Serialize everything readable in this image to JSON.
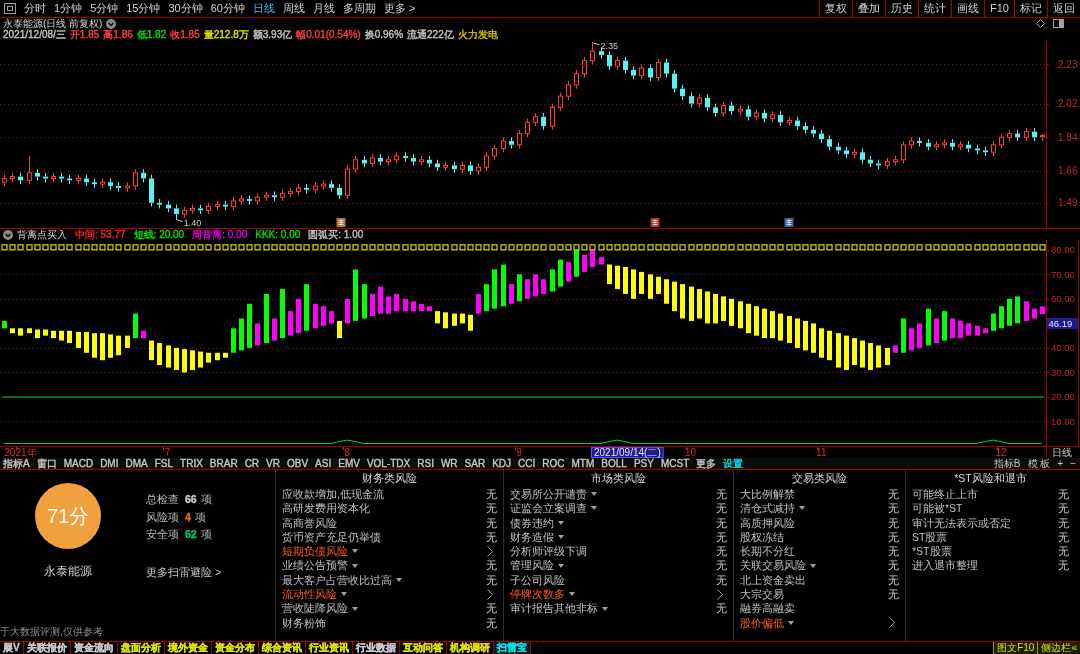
{
  "toolbar": {
    "periods": [
      {
        "label": "分时",
        "selected": false
      },
      {
        "label": "1分钟",
        "selected": false
      },
      {
        "label": "5分钟",
        "selected": false
      },
      {
        "label": "15分钟",
        "selected": false
      },
      {
        "label": "30分钟",
        "selected": false
      },
      {
        "label": "60分钟",
        "selected": false
      },
      {
        "label": "日线",
        "selected": true
      },
      {
        "label": "周线",
        "selected": false
      },
      {
        "label": "月线",
        "selected": false
      },
      {
        "label": "多周期",
        "selected": false
      },
      {
        "label": "更多 >",
        "selected": false
      }
    ],
    "actions": [
      "复权",
      "叠加",
      "历史",
      "统计",
      "画线",
      "F10",
      "标记",
      "返回"
    ]
  },
  "quote": {
    "title": "永泰能源(日线 前复权)",
    "fields": [
      {
        "text": "2021/12/08/三",
        "color": "#c8c8c8"
      },
      {
        "text": "开1.85",
        "color": "#ff4040"
      },
      {
        "text": "高1.86",
        "color": "#ff4040"
      },
      {
        "text": "低1.82",
        "color": "#00e000"
      },
      {
        "text": "收1.85",
        "color": "#ff4040"
      },
      {
        "text": "量212.8万",
        "color": "#e0e000"
      },
      {
        "text": "额3.93亿",
        "color": "#c8c8c8"
      },
      {
        "text": "幅0.01(0.54%)",
        "color": "#ff4040"
      },
      {
        "text": "换0.96%",
        "color": "#c8c8c8"
      },
      {
        "text": "流通222亿",
        "color": "#c8c8c8"
      },
      {
        "text": "火力发电",
        "color": "#e0c000"
      }
    ]
  },
  "chart": {
    "chart_data": [
      {
        "type": "candlestick",
        "ylim": [
          1.35,
          2.36
        ],
        "yticks": [
          2.23,
          2.02,
          1.84,
          1.66,
          1.49
        ],
        "tick_labels": "y",
        "grid": true,
        "annotations": [
          "2.35",
          "1.40"
        ],
        "ohlc": [
          [
            1.6,
            1.64,
            1.58,
            1.62
          ],
          [
            1.62,
            1.65,
            1.6,
            1.63
          ],
          [
            1.63,
            1.65,
            1.59,
            1.61
          ],
          [
            1.61,
            1.74,
            1.59,
            1.65
          ],
          [
            1.65,
            1.67,
            1.61,
            1.63
          ],
          [
            1.63,
            1.65,
            1.6,
            1.62
          ],
          [
            1.62,
            1.65,
            1.6,
            1.63
          ],
          [
            1.63,
            1.65,
            1.6,
            1.62
          ],
          [
            1.62,
            1.64,
            1.59,
            1.61
          ],
          [
            1.61,
            1.64,
            1.59,
            1.62
          ],
          [
            1.62,
            1.64,
            1.58,
            1.6
          ],
          [
            1.6,
            1.62,
            1.57,
            1.59
          ],
          [
            1.59,
            1.62,
            1.57,
            1.6
          ],
          [
            1.6,
            1.62,
            1.56,
            1.58
          ],
          [
            1.58,
            1.6,
            1.55,
            1.57
          ],
          [
            1.57,
            1.6,
            1.55,
            1.58
          ],
          [
            1.58,
            1.67,
            1.56,
            1.65
          ],
          [
            1.65,
            1.67,
            1.6,
            1.62
          ],
          [
            1.62,
            1.64,
            1.47,
            1.49
          ],
          [
            1.49,
            1.51,
            1.46,
            1.48
          ],
          [
            1.48,
            1.5,
            1.44,
            1.46
          ],
          [
            1.46,
            1.48,
            1.4,
            1.43
          ],
          [
            1.43,
            1.47,
            1.41,
            1.45
          ],
          [
            1.45,
            1.48,
            1.43,
            1.46
          ],
          [
            1.46,
            1.48,
            1.43,
            1.45
          ],
          [
            1.45,
            1.49,
            1.43,
            1.47
          ],
          [
            1.47,
            1.5,
            1.45,
            1.48
          ],
          [
            1.48,
            1.5,
            1.45,
            1.47
          ],
          [
            1.47,
            1.52,
            1.45,
            1.5
          ],
          [
            1.5,
            1.53,
            1.48,
            1.51
          ],
          [
            1.51,
            1.53,
            1.48,
            1.5
          ],
          [
            1.5,
            1.54,
            1.48,
            1.52
          ],
          [
            1.52,
            1.55,
            1.5,
            1.53
          ],
          [
            1.53,
            1.55,
            1.5,
            1.52
          ],
          [
            1.52,
            1.56,
            1.5,
            1.54
          ],
          [
            1.54,
            1.57,
            1.52,
            1.55
          ],
          [
            1.55,
            1.59,
            1.53,
            1.57
          ],
          [
            1.57,
            1.59,
            1.54,
            1.56
          ],
          [
            1.56,
            1.6,
            1.54,
            1.58
          ],
          [
            1.58,
            1.61,
            1.56,
            1.59
          ],
          [
            1.59,
            1.61,
            1.55,
            1.57
          ],
          [
            1.57,
            1.59,
            1.51,
            1.53
          ],
          [
            1.53,
            1.69,
            1.51,
            1.67
          ],
          [
            1.67,
            1.74,
            1.65,
            1.72
          ],
          [
            1.72,
            1.74,
            1.68,
            1.7
          ],
          [
            1.7,
            1.75,
            1.68,
            1.73
          ],
          [
            1.73,
            1.75,
            1.69,
            1.71
          ],
          [
            1.71,
            1.74,
            1.69,
            1.72
          ],
          [
            1.72,
            1.76,
            1.7,
            1.74
          ],
          [
            1.74,
            1.76,
            1.71,
            1.73
          ],
          [
            1.73,
            1.75,
            1.69,
            1.71
          ],
          [
            1.71,
            1.74,
            1.69,
            1.72
          ],
          [
            1.72,
            1.74,
            1.68,
            1.7
          ],
          [
            1.7,
            1.72,
            1.66,
            1.68
          ],
          [
            1.68,
            1.71,
            1.66,
            1.69
          ],
          [
            1.69,
            1.71,
            1.65,
            1.67
          ],
          [
            1.67,
            1.71,
            1.65,
            1.69
          ],
          [
            1.69,
            1.71,
            1.64,
            1.66
          ],
          [
            1.66,
            1.7,
            1.64,
            1.68
          ],
          [
            1.68,
            1.76,
            1.66,
            1.74
          ],
          [
            1.74,
            1.8,
            1.72,
            1.78
          ],
          [
            1.78,
            1.84,
            1.76,
            1.82
          ],
          [
            1.82,
            1.84,
            1.78,
            1.8
          ],
          [
            1.8,
            1.88,
            1.78,
            1.86
          ],
          [
            1.86,
            1.94,
            1.84,
            1.92
          ],
          [
            1.92,
            1.97,
            1.9,
            1.95
          ],
          [
            1.95,
            1.97,
            1.88,
            1.9
          ],
          [
            1.9,
            2.02,
            1.88,
            2.0
          ],
          [
            2.0,
            2.08,
            1.98,
            2.06
          ],
          [
            2.06,
            2.14,
            2.04,
            2.12
          ],
          [
            2.12,
            2.2,
            2.1,
            2.18
          ],
          [
            2.18,
            2.27,
            2.16,
            2.25
          ],
          [
            2.25,
            2.35,
            2.23,
            2.3
          ],
          [
            2.3,
            2.32,
            2.26,
            2.28
          ],
          [
            2.28,
            2.3,
            2.2,
            2.22
          ],
          [
            2.22,
            2.27,
            2.2,
            2.25
          ],
          [
            2.25,
            2.27,
            2.18,
            2.2
          ],
          [
            2.2,
            2.22,
            2.15,
            2.17
          ],
          [
            2.17,
            2.23,
            2.15,
            2.21
          ],
          [
            2.21,
            2.23,
            2.14,
            2.16
          ],
          [
            2.16,
            2.26,
            2.14,
            2.24
          ],
          [
            2.24,
            2.26,
            2.16,
            2.18
          ],
          [
            2.18,
            2.2,
            2.08,
            2.1
          ],
          [
            2.1,
            2.12,
            2.04,
            2.06
          ],
          [
            2.06,
            2.08,
            2.0,
            2.02
          ],
          [
            2.02,
            2.07,
            2.0,
            2.05
          ],
          [
            2.05,
            2.07,
            1.98,
            2.0
          ],
          [
            2.0,
            2.02,
            1.95,
            1.97
          ],
          [
            1.97,
            2.03,
            1.95,
            2.01
          ],
          [
            2.01,
            2.03,
            1.96,
            1.98
          ],
          [
            1.98,
            2.01,
            1.96,
            1.99
          ],
          [
            1.99,
            2.01,
            1.93,
            1.95
          ],
          [
            1.95,
            1.99,
            1.93,
            1.97
          ],
          [
            1.97,
            1.99,
            1.92,
            1.94
          ],
          [
            1.94,
            1.98,
            1.92,
            1.96
          ],
          [
            1.96,
            1.98,
            1.9,
            1.92
          ],
          [
            1.92,
            1.95,
            1.9,
            1.93
          ],
          [
            1.93,
            1.95,
            1.88,
            1.9
          ],
          [
            1.9,
            1.92,
            1.86,
            1.88
          ],
          [
            1.88,
            1.9,
            1.84,
            1.86
          ],
          [
            1.86,
            1.88,
            1.81,
            1.83
          ],
          [
            1.83,
            1.85,
            1.77,
            1.79
          ],
          [
            1.79,
            1.81,
            1.75,
            1.77
          ],
          [
            1.77,
            1.79,
            1.73,
            1.75
          ],
          [
            1.75,
            1.78,
            1.73,
            1.76
          ],
          [
            1.76,
            1.78,
            1.7,
            1.72
          ],
          [
            1.72,
            1.74,
            1.68,
            1.7
          ],
          [
            1.7,
            1.72,
            1.67,
            1.69
          ],
          [
            1.69,
            1.73,
            1.67,
            1.71
          ],
          [
            1.71,
            1.74,
            1.69,
            1.72
          ],
          [
            1.72,
            1.82,
            1.7,
            1.8
          ],
          [
            1.8,
            1.84,
            1.78,
            1.82
          ],
          [
            1.82,
            1.84,
            1.79,
            1.81
          ],
          [
            1.81,
            1.83,
            1.77,
            1.79
          ],
          [
            1.79,
            1.82,
            1.77,
            1.8
          ],
          [
            1.8,
            1.83,
            1.78,
            1.81
          ],
          [
            1.81,
            1.83,
            1.77,
            1.79
          ],
          [
            1.79,
            1.82,
            1.77,
            1.8
          ],
          [
            1.8,
            1.82,
            1.76,
            1.78
          ],
          [
            1.78,
            1.8,
            1.75,
            1.77
          ],
          [
            1.77,
            1.79,
            1.74,
            1.76
          ],
          [
            1.76,
            1.82,
            1.74,
            1.8
          ],
          [
            1.8,
            1.86,
            1.78,
            1.84
          ],
          [
            1.84,
            1.88,
            1.82,
            1.86
          ],
          [
            1.86,
            1.88,
            1.82,
            1.84
          ],
          [
            1.84,
            1.89,
            1.82,
            1.87
          ],
          [
            1.87,
            1.89,
            1.82,
            1.84
          ],
          [
            1.85,
            1.86,
            1.82,
            1.85
          ]
        ]
      },
      {
        "type": "bar",
        "ylim": [
          0,
          84
        ],
        "yticks": [
          {
            "value": 80,
            "label": "80.00"
          },
          {
            "value": 70,
            "label": "70.00"
          },
          {
            "value": 60,
            "label": "60.00"
          },
          {
            "value": 40,
            "label": "40.00"
          },
          {
            "value": 30,
            "label": "30.00"
          },
          {
            "value": 20,
            "label": "20.00"
          },
          {
            "value": 10,
            "label": "10.00"
          }
        ],
        "grid": true,
        "categories": [
          null,
          null,
          "2021年",
          null,
          null,
          null,
          null,
          null,
          null,
          null,
          null,
          null,
          null,
          null,
          null,
          null,
          null,
          null,
          null,
          null,
          "7",
          null,
          null,
          null,
          null,
          null,
          null,
          null,
          null,
          null,
          null,
          null,
          null,
          null,
          null,
          null,
          null,
          null,
          null,
          null,
          null,
          null,
          "8",
          null,
          null,
          null,
          null,
          null,
          null,
          null,
          null,
          null,
          null,
          null,
          null,
          null,
          null,
          null,
          null,
          null,
          null,
          null,
          null,
          "9",
          null,
          null,
          null,
          null,
          null,
          null,
          null,
          null,
          null,
          null,
          null,
          null,
          null,
          null,
          null,
          null,
          null,
          null,
          null,
          null,
          "10",
          null,
          null,
          null,
          null,
          null,
          null,
          null,
          null,
          null,
          null,
          null,
          null,
          null,
          null,
          null,
          "11",
          null,
          null,
          null,
          null,
          null,
          null,
          null,
          null,
          null,
          null,
          null,
          null,
          null,
          null,
          null,
          null,
          null,
          null,
          null,
          null,
          null,
          "12",
          null,
          null,
          null,
          null,
          null
        ],
        "ref_lines": [
          {
            "axis": "y",
            "value": 20,
            "color": "#00e000"
          }
        ],
        "series": [
          {
            "type": "bar",
            "base": [
              48,
              48,
              48,
              48,
              47.5,
              47.5,
              47,
              47,
              47,
              46.5,
              46.5,
              46,
              46,
              45.5,
              45,
              45,
              44,
              44,
              43,
              42,
              41,
              40,
              39.5,
              39,
              38.5,
              38,
              38,
              38,
              38,
              39,
              40,
              41,
              42,
              43,
              44,
              45,
              46,
              47,
              48,
              49,
              50,
              51,
              50,
              51,
              52,
              53,
              54,
              54,
              55,
              55,
              55,
              55,
              55,
              55,
              54.5,
              54,
              54,
              53.5,
              54,
              55,
              56,
              57,
              58,
              59,
              60,
              61,
              62,
              63,
              65,
              67,
              69,
              71,
              73,
              74,
              74,
              73.5,
              73,
              72,
              71,
              70,
              69,
              68,
              67,
              66,
              65,
              64,
              63,
              62,
              61,
              60,
              59,
              58,
              57,
              56,
              55,
              54,
              53,
              52,
              51,
              50,
              48,
              47,
              46,
              45,
              44,
              43,
              42,
              41,
              40,
              38,
              38,
              39,
              40,
              41,
              42,
              43,
              44,
              44,
              45,
              45,
              46,
              47,
              48,
              49,
              50,
              51,
              52,
              53.77
            ],
            "values": [
              3,
              -2,
              -3,
              -2,
              -3.5,
              -2.5,
              -3,
              -4,
              -5,
              -6.5,
              -8.5,
              -10,
              -11,
              -9.5,
              -8,
              -5,
              10,
              3,
              -8,
              -9,
              -9,
              -9,
              -9.5,
              -8,
              -6.5,
              -4,
              -3,
              -2,
              10,
              13,
              18,
              9,
              20,
              9,
              20,
              10,
              14,
              19,
              10,
              8,
              5,
              -7,
              10,
              21,
              14,
              9,
              11,
              7,
              7,
              5,
              4,
              3,
              2,
              -5,
              -6.5,
              -5,
              -4,
              -6.5,
              8,
              11,
              16,
              17,
              8,
              11,
              8,
              9,
              6,
              9,
              11,
              8,
              11,
              7,
              7,
              3,
              -8,
              -9.5,
              -11,
              -12,
              -9,
              -10,
              -7,
              -10,
              -12,
              -14,
              -14,
              -12,
              -13,
              -12,
              -10,
              -11,
              -11,
              -12,
              -12,
              -12,
              -11,
              -11,
              -11,
              -12,
              -12,
              -12,
              -12,
              -12,
              -14,
              -14,
              -11,
              -11,
              -11,
              -9,
              -7,
              3,
              14,
              9,
              10,
              15,
              10,
              12,
              8,
              7,
              5,
              4,
              2,
              7,
              9,
              11,
              11,
              8,
              4,
              3.2
            ],
            "colors": [
              "#00ff00",
              "#ffff00",
              "#ffff00",
              "#ffff00",
              "#ffff00",
              "#ffff00",
              "#ffff00",
              "#ffff00",
              "#ffff00",
              "#ffff00",
              "#ffff00",
              "#ffff00",
              "#ffff00",
              "#ffff00",
              "#ffff00",
              "#ffff00",
              "#00ff00",
              "#ff00ff",
              "#ffff00",
              "#ffff00",
              "#ffff00",
              "#ffff00",
              "#ffff00",
              "#ffff00",
              "#ffff00",
              "#ffff00",
              "#ffff00",
              "#ffff00",
              "#00ff00",
              "#00ff00",
              "#00ff00",
              "#ff00ff",
              "#00ff00",
              "#ff00ff",
              "#00ff00",
              "#ff00ff",
              "#ff00ff",
              "#00ff00",
              "#ff00ff",
              "#ff00ff",
              "#ff00ff",
              "#ffff00",
              "#ff00ff",
              "#00ff00",
              "#00ff00",
              "#ff00ff",
              "#ff00ff",
              "#ff00ff",
              "#ff00ff",
              "#ff00ff",
              "#ff00ff",
              "#ff00ff",
              "#ff00ff",
              "#ffff00",
              "#ffff00",
              "#ffff00",
              "#ffff00",
              "#ffff00",
              "#ff00ff",
              "#00ff00",
              "#00ff00",
              "#00ff00",
              "#ff00ff",
              "#00ff00",
              "#ff00ff",
              "#ff00ff",
              "#ff00ff",
              "#00ff00",
              "#00ff00",
              "#ff00ff",
              "#00ff00",
              "#ff00ff",
              "#ff00ff",
              "#ff00ff",
              "#ffff00",
              "#ffff00",
              "#ffff00",
              "#ffff00",
              "#ffff00",
              "#ffff00",
              "#ffff00",
              "#ffff00",
              "#ffff00",
              "#ffff00",
              "#ffff00",
              "#ffff00",
              "#ffff00",
              "#ffff00",
              "#ffff00",
              "#ffff00",
              "#ffff00",
              "#ffff00",
              "#ffff00",
              "#ffff00",
              "#ffff00",
              "#ffff00",
              "#ffff00",
              "#ffff00",
              "#ffff00",
              "#ffff00",
              "#ffff00",
              "#ffff00",
              "#ffff00",
              "#ffff00",
              "#ffff00",
              "#ffff00",
              "#ffff00",
              "#ffff00",
              "#ffff00",
              "#ff00ff",
              "#00ff00",
              "#ff00ff",
              "#ff00ff",
              "#00ff00",
              "#ff00ff",
              "#00ff00",
              "#ff00ff",
              "#ff00ff",
              "#ff00ff",
              "#ff00ff",
              "#ff00ff",
              "#00ff00",
              "#00ff00",
              "#00ff00",
              "#00ff00",
              "#ff00ff",
              "#ff00ff",
              "#ff00ff"
            ]
          },
          {
            "type": "scatter",
            "color": "#d8d800",
            "values": [
              81,
              81,
              81,
              81,
              81,
              81,
              81,
              81,
              81,
              81,
              81,
              81,
              81,
              81,
              81,
              81,
              81,
              81,
              81,
              81,
              81,
              81,
              81,
              81,
              81,
              81,
              81,
              81,
              81,
              81,
              81,
              81,
              81,
              81,
              81,
              81,
              81,
              81,
              81,
              81,
              81,
              81,
              81,
              81,
              81,
              81,
              81,
              81,
              81,
              81,
              81,
              81,
              81,
              81,
              81,
              81,
              81,
              81,
              81,
              81,
              81,
              81,
              81,
              81,
              81,
              81,
              81,
              81,
              81,
              81,
              81,
              81,
              81,
              81,
              81,
              81,
              81,
              81,
              81,
              81,
              81,
              81,
              81,
              81,
              81,
              81,
              81,
              81,
              81,
              81,
              81,
              81,
              81,
              81,
              81,
              81,
              81,
              81,
              81,
              81,
              81,
              81,
              81,
              81,
              81,
              81,
              81,
              81,
              81,
              81,
              81,
              81,
              81,
              81,
              81,
              81,
              81,
              81,
              81,
              81,
              81,
              81,
              81,
              81,
              81,
              81,
              81,
              81
            ]
          },
          {
            "type": "line",
            "color": "#00e000",
            "values": [
              1,
              1,
              1,
              1,
              1,
              1,
              1,
              1,
              1,
              1,
              1,
              1,
              1,
              1,
              1,
              1,
              1,
              1,
              1,
              1,
              1,
              1,
              1,
              1,
              1,
              1,
              1,
              1,
              1,
              1,
              1,
              1,
              1,
              1,
              1,
              1,
              1,
              1,
              1,
              1,
              1,
              1.8,
              2.4,
              1.8,
              1,
              1,
              1,
              1,
              1,
              1,
              1,
              1,
              1,
              1,
              1,
              1,
              1,
              1,
              1,
              1,
              1,
              1,
              1,
              1,
              1,
              1,
              1,
              1,
              1,
              1,
              1,
              1,
              1,
              1,
              1.8,
              2.4,
              1.8,
              1,
              1,
              1,
              1,
              1,
              1,
              1,
              1,
              1,
              1,
              1,
              1,
              1,
              1,
              1,
              1,
              1,
              1,
              1,
              1,
              1,
              1,
              1,
              1,
              1,
              1,
              1,
              1,
              1,
              1,
              1,
              1,
              1,
              1,
              1,
              1,
              1,
              1,
              1,
              1,
              1,
              1,
              1,
              1.8,
              2.4,
              1.8,
              1,
              1,
              1,
              1,
              1
            ]
          }
        ]
      }
    ],
    "event_marks": [
      {
        "color": "#b07040"
      },
      {
        "color": "#b03838"
      },
      {
        "color": "#3a6aa0"
      }
    ],
    "indicator_name": "背离点买入",
    "indicator_legend": [
      {
        "label": "中间: 53.77",
        "color": "#ff2020"
      },
      {
        "label": "短线: 20.00",
        "color": "#00e000"
      },
      {
        "label": "周背离: 0.00",
        "color": "#e000e0"
      },
      {
        "label": "KKK: 0.00",
        "color": "#00e000"
      },
      {
        "label": "圆弧买: 1.00",
        "color": "#c0c0c0"
      }
    ],
    "cursor_value": "46.19",
    "cursor_date": "2021/09/14(二)",
    "period_label": "日线"
  },
  "indicator_tabs": {
    "left": [
      {
        "label": "指标A",
        "color": "#c8c8c8"
      },
      {
        "label": "窗口",
        "color": "#c8c8c8"
      },
      {
        "label": "MACD",
        "color": "#c8c8c8"
      },
      {
        "label": "DMI",
        "color": "#c8c8c8"
      },
      {
        "label": "DMA",
        "color": "#c8c8c8"
      },
      {
        "label": "FSL",
        "color": "#c8c8c8"
      },
      {
        "label": "TRIX",
        "color": "#c8c8c8"
      },
      {
        "label": "BRAR",
        "color": "#c8c8c8"
      },
      {
        "label": "CR",
        "color": "#c8c8c8"
      },
      {
        "label": "VR",
        "color": "#c8c8c8"
      },
      {
        "label": "OBV",
        "color": "#c8c8c8"
      },
      {
        "label": "ASI",
        "color": "#c8c8c8"
      },
      {
        "label": "EMV",
        "color": "#c8c8c8"
      },
      {
        "label": "VOL-TDX",
        "color": "#c8c8c8"
      },
      {
        "label": "RSI",
        "color": "#c8c8c8"
      },
      {
        "label": "WR",
        "color": "#c8c8c8"
      },
      {
        "label": "SAR",
        "color": "#c8c8c8"
      },
      {
        "label": "KDJ",
        "color": "#c8c8c8"
      },
      {
        "label": "CCI",
        "color": "#c8c8c8"
      },
      {
        "label": "ROC",
        "color": "#c8c8c8"
      },
      {
        "label": "MTM",
        "color": "#c8c8c8"
      },
      {
        "label": "BOLL",
        "color": "#c8c8c8"
      },
      {
        "label": "PSY",
        "color": "#c8c8c8"
      },
      {
        "label": "MCST",
        "color": "#c8c8c8"
      },
      {
        "label": "更多",
        "color": "#c8c8c8"
      },
      {
        "label": "设置",
        "color": "#00e0e0"
      }
    ],
    "right": [
      "指标B",
      "模 板",
      "+",
      "−"
    ]
  },
  "scan": {
    "score": "71分",
    "stock_name": "永泰能源",
    "stats": [
      {
        "label": "总检查",
        "value": "66",
        "unit": "项",
        "color": "#c8c8c8"
      },
      {
        "label": "风险项",
        "value": "4",
        "unit": "项",
        "color": "#ff6a00"
      },
      {
        "label": "安全项",
        "value": "62",
        "unit": "项",
        "color": "#00c060"
      }
    ],
    "more_link": "更多扫雷避险 >",
    "note": "于大数据评测,仅供参考",
    "columns": [
      {
        "title": "财务类风险",
        "items": [
          {
            "label": "应收款增加,低现金流",
            "menu": false,
            "flagged": false,
            "value": "无"
          },
          {
            "label": "高研发费用资本化",
            "menu": false,
            "flagged": false,
            "value": "无"
          },
          {
            "label": "高商誉风险",
            "menu": false,
            "flagged": false,
            "value": "无"
          },
          {
            "label": "货币资产充足仍举债",
            "menu": false,
            "flagged": false,
            "value": "无"
          },
          {
            "label": "短期负债风险",
            "menu": true,
            "flagged": true
          },
          {
            "label": "业绩公告预警",
            "menu": true,
            "flagged": false,
            "value": "无"
          },
          {
            "label": "最大客户占营收比过高",
            "menu": true,
            "flagged": false,
            "value": "无"
          },
          {
            "label": "流动性风险",
            "menu": true,
            "flagged": true
          },
          {
            "label": "营收陡降风险",
            "menu": true,
            "flagged": false,
            "value": "无"
          },
          {
            "label": "财务粉饰",
            "menu": false,
            "flagged": false,
            "value": "无"
          }
        ]
      },
      {
        "title": "市场类风险",
        "items": [
          {
            "label": "交易所公开谴责",
            "menu": true,
            "flagged": false,
            "value": "无"
          },
          {
            "label": "证监会立案调查",
            "menu": true,
            "flagged": false,
            "value": "无"
          },
          {
            "label": "债券违约",
            "menu": true,
            "flagged": false,
            "value": "无"
          },
          {
            "label": "财务造假",
            "menu": true,
            "flagged": false,
            "value": "无"
          },
          {
            "label": "分析师评级下调",
            "menu": false,
            "flagged": false,
            "value": "无"
          },
          {
            "label": "管理风险",
            "menu": true,
            "flagged": false,
            "value": "无"
          },
          {
            "label": "子公司风险",
            "menu": false,
            "flagged": false,
            "value": "无"
          },
          {
            "label": "停牌次数多",
            "menu": true,
            "flagged": true
          },
          {
            "label": "审计报告其他非标",
            "menu": true,
            "flagged": false,
            "value": "无"
          }
        ]
      },
      {
        "title": "交易类风险",
        "items": [
          {
            "label": "大比例解禁",
            "menu": false,
            "flagged": false,
            "value": "无"
          },
          {
            "label": "清仓式减持",
            "menu": true,
            "flagged": false,
            "value": "无"
          },
          {
            "label": "高质押风险",
            "menu": false,
            "flagged": false,
            "value": "无"
          },
          {
            "label": "股权冻结",
            "menu": false,
            "flagged": false,
            "value": "无"
          },
          {
            "label": "长期不分红",
            "menu": false,
            "flagged": false,
            "value": "无"
          },
          {
            "label": "关联交易风险",
            "menu": true,
            "flagged": false,
            "value": "无"
          },
          {
            "label": "北上资金卖出",
            "menu": false,
            "flagged": false,
            "value": "无"
          },
          {
            "label": "大宗交易",
            "menu": false,
            "flagged": false,
            "value": "无"
          },
          {
            "label": "融券高融卖",
            "menu": false,
            "flagged": false
          },
          {
            "label": "股价偏低",
            "menu": true,
            "flagged": true
          }
        ]
      },
      {
        "title": "*ST风险和退市",
        "items": [
          {
            "label": "可能终止上市",
            "menu": false,
            "flagged": false,
            "value": "无"
          },
          {
            "label": "可能被*ST",
            "menu": false,
            "flagged": false,
            "value": "无"
          },
          {
            "label": "审计无法表示或否定",
            "menu": false,
            "flagged": false,
            "value": "无"
          },
          {
            "label": "ST股票",
            "menu": false,
            "flagged": false,
            "value": "无"
          },
          {
            "label": "*ST股票",
            "menu": false,
            "flagged": false,
            "value": "无"
          },
          {
            "label": "进入退市整理",
            "menu": false,
            "flagged": false,
            "value": "无"
          }
        ]
      }
    ]
  },
  "bottom_tabs": [
    {
      "label": "展V",
      "color": "#c8c8c8",
      "selected": false
    },
    {
      "label": "关联报价",
      "color": "#c8c8c8",
      "selected": false
    },
    {
      "label": "资金流向",
      "color": "#c8c8c8",
      "selected": false
    },
    {
      "label": "盘面分析",
      "color": "#e0e000",
      "selected": false
    },
    {
      "label": "境外资金",
      "color": "#e0e000",
      "selected": false
    },
    {
      "label": "资金分布",
      "color": "#e0e000",
      "selected": false
    },
    {
      "label": "综合资讯",
      "color": "#e0e000",
      "selected": false
    },
    {
      "label": "行业资讯",
      "color": "#e0e000",
      "selected": false
    },
    {
      "label": "行业数据",
      "color": "#c8c8c8",
      "selected": false
    },
    {
      "label": "互动问答",
      "color": "#e0e000",
      "selected": false
    },
    {
      "label": "机构调研",
      "color": "#e0e000",
      "selected": false
    },
    {
      "label": "扫雷宝",
      "color": "#00e0e0",
      "selected": true
    }
  ],
  "bottom_actions": [
    "图文F10",
    "侧边栏«"
  ]
}
